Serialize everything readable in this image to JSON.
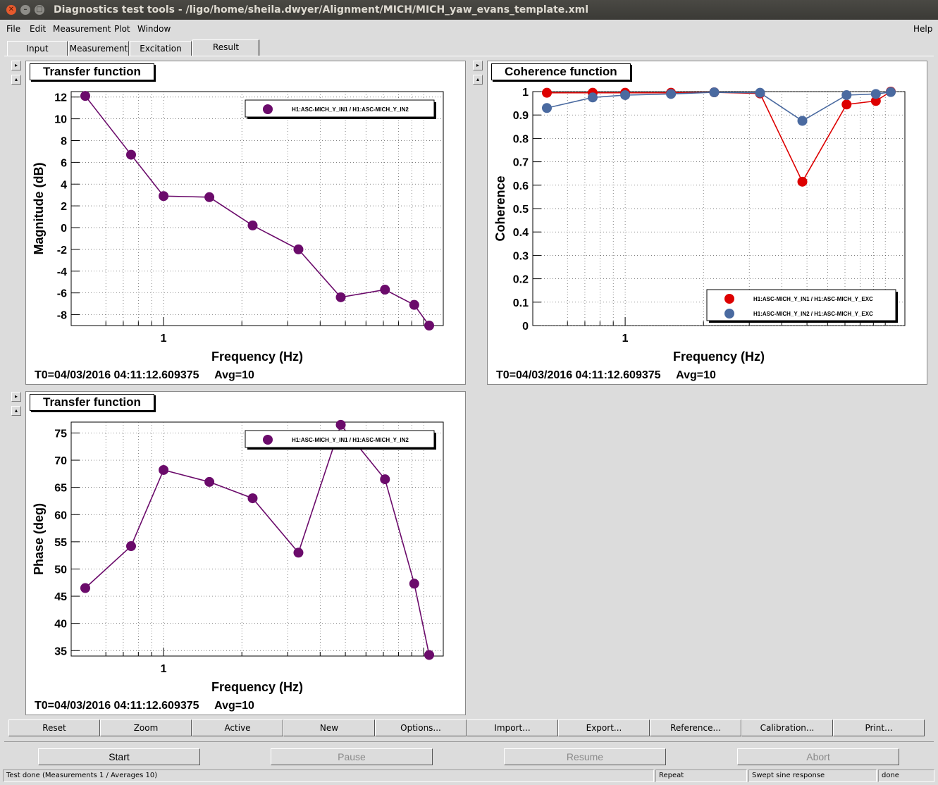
{
  "window": {
    "title": "Diagnostics test tools - /ligo/home/sheila.dwyer/Alignment/MICH/MICH_yaw_evans_template.xml"
  },
  "menu": {
    "file": "File",
    "edit": "Edit",
    "measurement": "Measurement",
    "plot": "Plot",
    "window": "Window",
    "help": "Help"
  },
  "tabs": [
    "Input",
    "Measurement",
    "Excitation",
    "Result"
  ],
  "panels": {
    "magnitude": {
      "title": "Transfer function",
      "info": "T0=04/03/2016 04:11:12.609375     Avg=10"
    },
    "coherence": {
      "title": "Coherence function",
      "info": "T0=04/03/2016 04:11:12.609375     Avg=10"
    },
    "phase": {
      "title": "Transfer function",
      "info": "T0=04/03/2016 04:11:12.609375     Avg=10"
    }
  },
  "toolbar": [
    "Reset",
    "Zoom",
    "Active",
    "New",
    "Options...",
    "Import...",
    "Export...",
    "Reference...",
    "Calibration...",
    "Print..."
  ],
  "control": {
    "start": "Start",
    "pause": "Pause",
    "resume": "Resume",
    "abort": "Abort"
  },
  "statusbar": {
    "message": "Test done (Measurements 1 / Averages 10)",
    "repeat": "Repeat",
    "type": "Swept sine response",
    "state": "done"
  },
  "colors": {
    "purple": "#6b0b6b",
    "red": "#dd0000",
    "blue": "#4a6aa0",
    "titlebar": "#3c3b37"
  },
  "chart_data": [
    {
      "type": "line",
      "title": "Transfer function",
      "xlabel": "Frequency (Hz)",
      "ylabel": "Magnitude (dB)",
      "xscale": "log",
      "xlim": [
        0.5,
        10.5
      ],
      "ylim": [
        -9,
        12.5
      ],
      "yticks": [
        12,
        10,
        8,
        6,
        4,
        2,
        0,
        -2,
        -4,
        -6,
        -8
      ],
      "xtick_labels": [
        "1"
      ],
      "grid": true,
      "legend_position": "top-right",
      "series": [
        {
          "name": "H1:ASC-MICH_Y_IN1 / H1:ASC-MICH_Y_IN2",
          "color": "#6b0b6b",
          "x": [
            0.5,
            0.75,
            1.0,
            1.5,
            2.2,
            3.3,
            4.8,
            7.1,
            9.2,
            10.5
          ],
          "y": [
            12.1,
            6.7,
            2.9,
            2.8,
            0.2,
            -2.0,
            -6.4,
            -5.7,
            -7.1,
            -9.0
          ]
        }
      ],
      "info": "T0=04/03/2016 04:11:12.609375     Avg=10"
    },
    {
      "type": "line",
      "title": "Coherence function",
      "xlabel": "Frequency (Hz)",
      "ylabel": "Coherence",
      "xscale": "log",
      "xlim": [
        0.5,
        10.5
      ],
      "ylim": [
        0,
        1
      ],
      "yticks": [
        1,
        0.9,
        0.8,
        0.7,
        0.6,
        0.5,
        0.4,
        0.3,
        0.2,
        0.1,
        0
      ],
      "xtick_labels": [
        "1"
      ],
      "grid": true,
      "legend_position": "bottom-right",
      "series": [
        {
          "name": "H1:ASC-MICH_Y_IN1 / H1:ASC-MICH_Y_EXC",
          "color": "#dd0000",
          "x": [
            0.5,
            0.75,
            1.0,
            1.5,
            2.2,
            3.3,
            4.8,
            7.1,
            9.2,
            10.5
          ],
          "y": [
            0.995,
            0.995,
            0.995,
            0.995,
            0.997,
            0.992,
            0.615,
            0.945,
            0.96,
            1.0
          ]
        },
        {
          "name": "H1:ASC-MICH_Y_IN2 / H1:ASC-MICH_Y_EXC",
          "color": "#4a6aa0",
          "x": [
            0.5,
            0.75,
            1.0,
            1.5,
            2.2,
            3.3,
            4.8,
            7.1,
            9.2,
            10.5
          ],
          "y": [
            0.93,
            0.975,
            0.985,
            0.99,
            0.997,
            0.995,
            0.875,
            0.985,
            0.99,
            0.998
          ]
        }
      ],
      "info": "T0=04/03/2016 04:11:12.609375     Avg=10"
    },
    {
      "type": "line",
      "title": "Transfer function",
      "xlabel": "Frequency (Hz)",
      "ylabel": "Phase (deg)",
      "xscale": "log",
      "xlim": [
        0.5,
        10.5
      ],
      "ylim": [
        34,
        77
      ],
      "yticks": [
        75,
        70,
        65,
        60,
        55,
        50,
        45,
        40,
        35
      ],
      "xtick_labels": [
        "1"
      ],
      "grid": true,
      "legend_position": "top-right",
      "series": [
        {
          "name": "H1:ASC-MICH_Y_IN1 / H1:ASC-MICH_Y_IN2",
          "color": "#6b0b6b",
          "x": [
            0.5,
            0.75,
            1.0,
            1.5,
            2.2,
            3.3,
            4.8,
            7.1,
            9.2,
            10.5
          ],
          "y": [
            46.5,
            54.2,
            68.2,
            66.0,
            63.0,
            53.0,
            76.5,
            66.5,
            47.3,
            34.2
          ]
        }
      ],
      "info": "T0=04/03/2016 04:11:12.609375     Avg=10"
    }
  ]
}
